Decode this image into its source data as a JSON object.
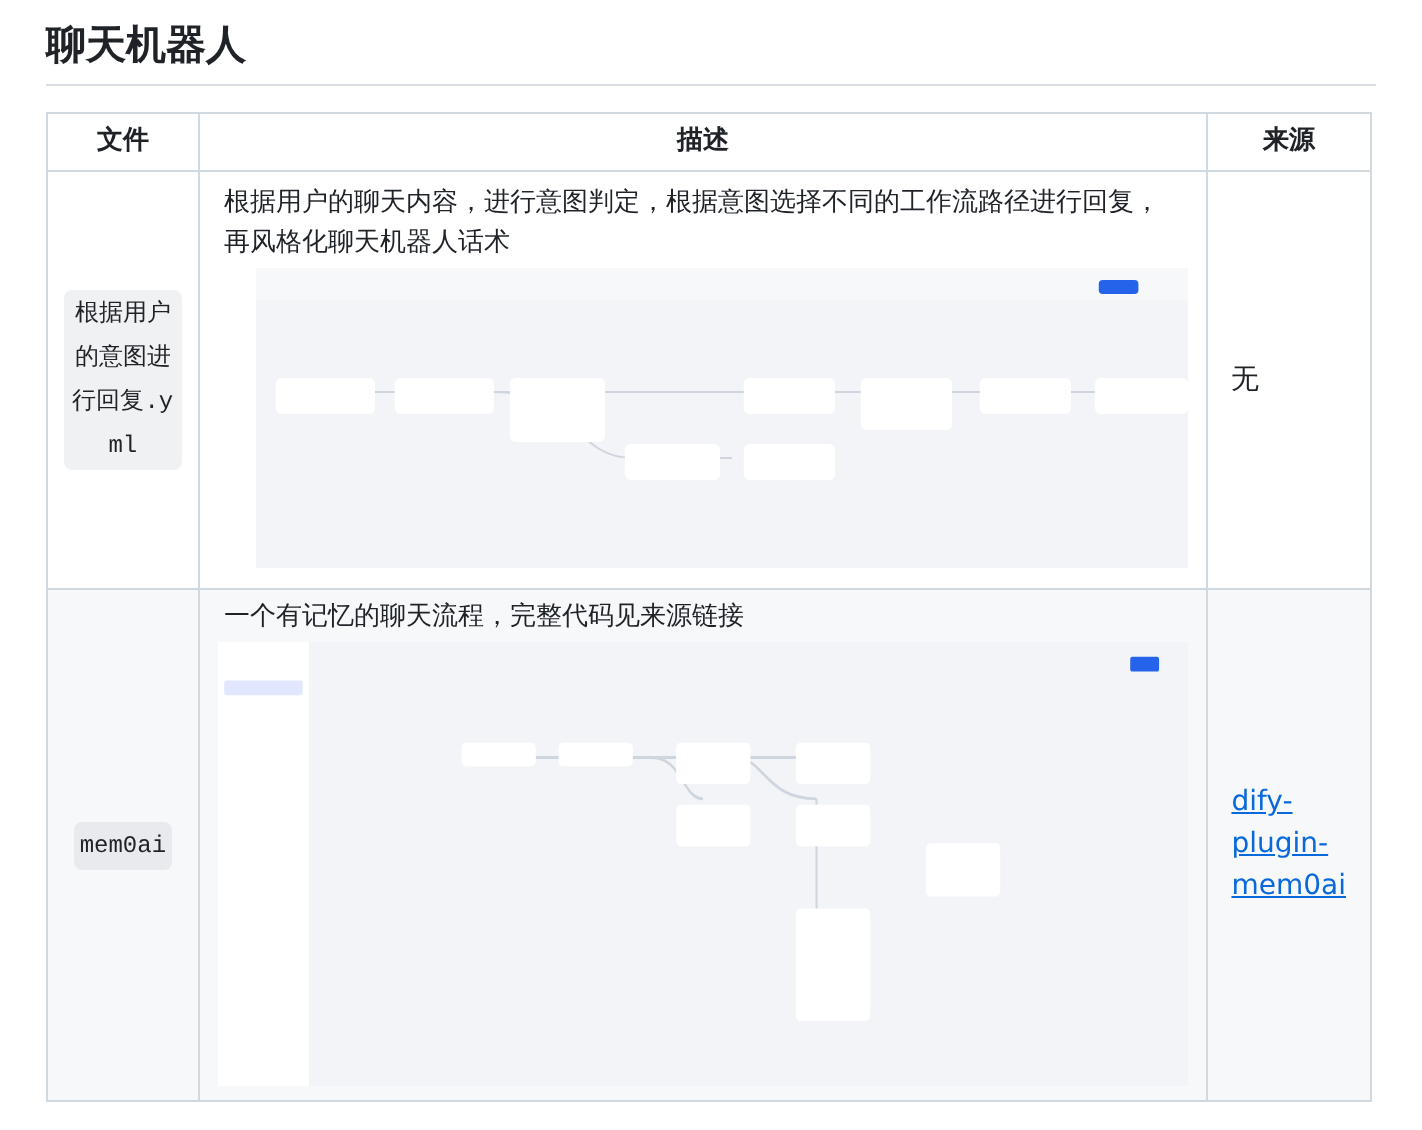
{
  "heading": "聊天机器人",
  "table": {
    "columns": [
      "文件",
      "描述",
      "来源"
    ],
    "rows": [
      {
        "file": "根据用户的意图进行回复.yml",
        "description": "根据用户的聊天内容，进行意图判定，根据意图选择不同的工作流路径进行回复，再风格化聊天机器人话术",
        "source": {
          "kind": "text",
          "text": "无"
        }
      },
      {
        "file": "mem0ai",
        "description": "一个有记忆的聊天流程，完整代码见来源链接",
        "source": {
          "kind": "link",
          "text": "dify-plugin-mem0ai"
        }
      }
    ]
  }
}
